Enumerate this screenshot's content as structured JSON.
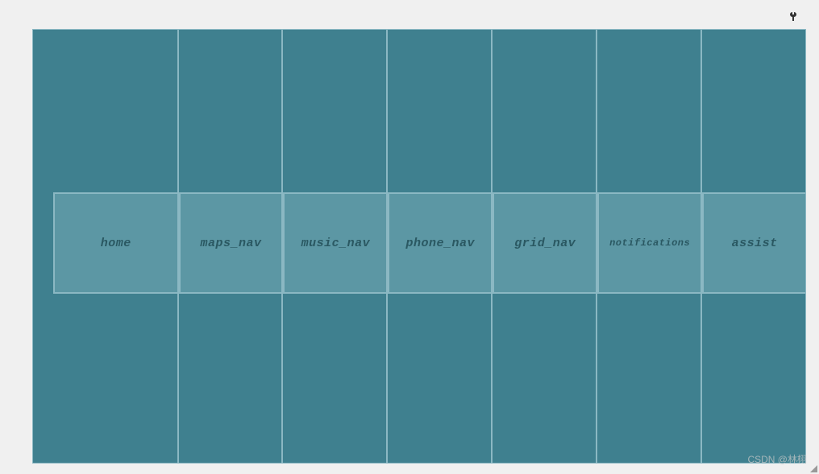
{
  "nav": {
    "items": [
      {
        "label": "home",
        "small": false
      },
      {
        "label": "maps_nav",
        "small": false
      },
      {
        "label": "music_nav",
        "small": false
      },
      {
        "label": "phone_nav",
        "small": false
      },
      {
        "label": "grid_nav",
        "small": false
      },
      {
        "label": "notifications",
        "small": true
      },
      {
        "label": "assist",
        "small": false
      }
    ]
  },
  "watermark": "CSDN @林栩"
}
